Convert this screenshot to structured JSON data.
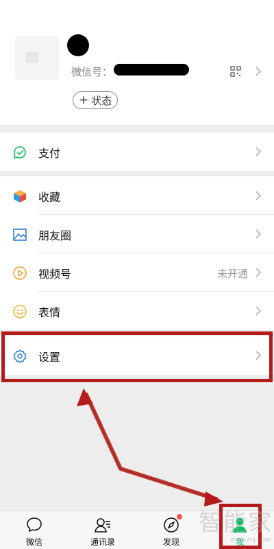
{
  "profile": {
    "wechat_id_label": "微信号：",
    "status_button": "状态",
    "status_plus": "+"
  },
  "menu": {
    "pay": {
      "label": "支付"
    },
    "favorites": {
      "label": "收藏"
    },
    "moments": {
      "label": "朋友圈"
    },
    "channels": {
      "label": "视频号",
      "status": "未开通"
    },
    "stickers": {
      "label": "表情"
    },
    "settings": {
      "label": "设置"
    }
  },
  "tabs": [
    {
      "label": "微信"
    },
    {
      "label": "通讯录"
    },
    {
      "label": "发现"
    },
    {
      "label": "我"
    }
  ],
  "watermark": {
    "text": "智能家",
    "sub": "www.znj.com"
  },
  "colors": {
    "accent": "#07c160",
    "highlight": "#b41c1c",
    "badge": "#fa5151",
    "background": "#ededed"
  }
}
